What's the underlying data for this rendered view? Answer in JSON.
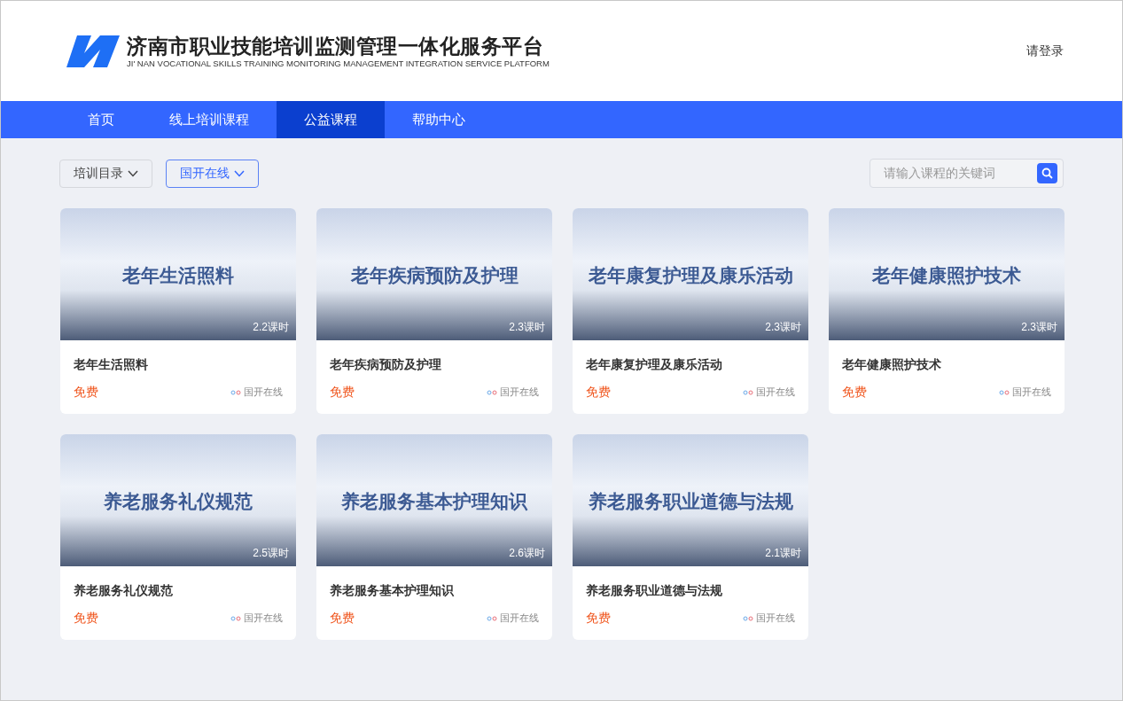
{
  "header": {
    "title": "济南市职业技能培训监测管理一体化服务平台",
    "subtitle": "JI' NAN VOCATIONAL SKILLS TRAINING MONITORING MANAGEMENT INTEGRATION SERVICE PLATFORM",
    "login": "请登录"
  },
  "nav": [
    {
      "label": "首页",
      "selected": false
    },
    {
      "label": "线上培训课程",
      "selected": false
    },
    {
      "label": "公益课程",
      "selected": true
    },
    {
      "label": "帮助中心",
      "selected": false
    }
  ],
  "filters": [
    {
      "label": "培训目录",
      "selected": false
    },
    {
      "label": "国开在线",
      "selected": true
    }
  ],
  "search": {
    "placeholder": "请输入课程的关键词"
  },
  "courses": [
    {
      "cover_title": "老年生活照料",
      "hours": "2.2课时",
      "title": "老年生活照料",
      "price": "免费",
      "provider": "国开在线"
    },
    {
      "cover_title": "老年疾病预防及护理",
      "hours": "2.3课时",
      "title": "老年疾病预防及护理",
      "price": "免费",
      "provider": "国开在线"
    },
    {
      "cover_title": "老年康复护理及康乐活动",
      "hours": "2.3课时",
      "title": "老年康复护理及康乐活动",
      "price": "免费",
      "provider": "国开在线"
    },
    {
      "cover_title": "老年健康照护技术",
      "hours": "2.3课时",
      "title": "老年健康照护技术",
      "price": "免费",
      "provider": "国开在线"
    },
    {
      "cover_title": "养老服务礼仪规范",
      "hours": "2.5课时",
      "title": "养老服务礼仪规范",
      "price": "免费",
      "provider": "国开在线"
    },
    {
      "cover_title": "养老服务基本护理知识",
      "hours": "2.6课时",
      "title": "养老服务基本护理知识",
      "price": "免费",
      "provider": "国开在线"
    },
    {
      "cover_title": "养老服务职业道德与法规",
      "hours": "2.1课时",
      "title": "养老服务职业道德与法规",
      "price": "免费",
      "provider": "国开在线"
    }
  ]
}
